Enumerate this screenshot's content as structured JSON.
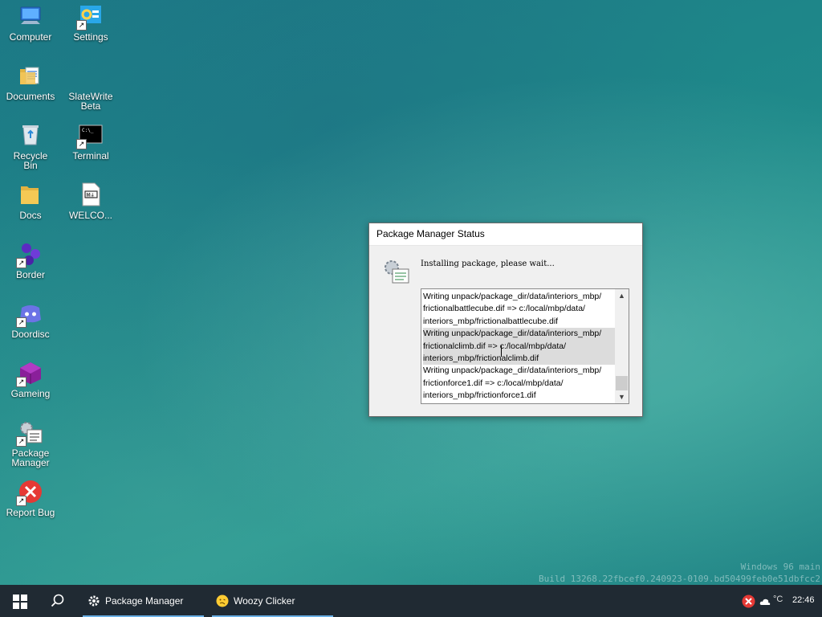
{
  "desktop": {
    "icons": [
      {
        "label": "Computer",
        "icon": "computer-icon"
      },
      {
        "label": "Settings",
        "icon": "settings-icon"
      },
      {
        "label": "Documents",
        "icon": "documents-folder-icon"
      },
      {
        "label": "SlateWrite\nBeta",
        "icon": "slatewrite-icon"
      },
      {
        "label": "Recycle\nBin",
        "icon": "recycle-bin-icon"
      },
      {
        "label": "Terminal",
        "icon": "terminal-icon"
      },
      {
        "label": "Docs",
        "icon": "folder-icon"
      },
      {
        "label": "WELCO...",
        "icon": "markdown-file-icon"
      },
      {
        "label": "Border",
        "icon": "border-icon"
      },
      {
        "label": "Doordisc",
        "icon": "doordisc-icon"
      },
      {
        "label": "Gameing",
        "icon": "gameing-cube-icon"
      },
      {
        "label": "Package\nManager",
        "icon": "package-manager-icon"
      },
      {
        "label": "Report Bug",
        "icon": "report-bug-icon"
      }
    ]
  },
  "watermark": {
    "line1": "Windows 96 main",
    "line2": "Build 13268.22fbcef0.240923-0109.bd50499feb0e51dbfcc2"
  },
  "dialog": {
    "title": "Package Manager Status",
    "message": "Installing package, please wait...",
    "log": [
      "Writing unpack/package_dir/data/interiors_mbp/",
      "frictionalbattlecube.dif => c:/local/mbp/data/",
      "interiors_mbp/frictionalbattlecube.dif",
      "Writing unpack/package_dir/data/interiors_mbp/",
      "frictionalclimb.dif => c:/local/mbp/data/",
      "interiors_mbp/frictionalclimb.dif",
      "Writing unpack/package_dir/data/interiors_mbp/",
      "frictionforce1.dif => c:/local/mbp/data/",
      "interiors_mbp/frictionforce1.dif"
    ]
  },
  "taskbar": {
    "apps": [
      {
        "label": "Package Manager",
        "icon": "gear-icon"
      },
      {
        "label": "Woozy Clicker",
        "icon": "woozy-face-icon"
      }
    ],
    "tray": {
      "temperature": "°C",
      "clock": "22:46"
    }
  }
}
